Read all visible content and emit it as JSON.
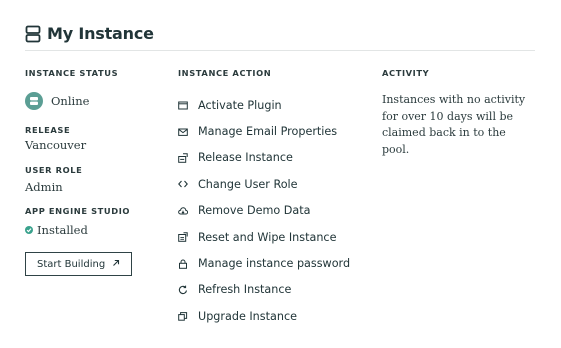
{
  "header": {
    "title": "My Instance"
  },
  "status": {
    "label": "INSTANCE STATUS",
    "value": "Online",
    "release_label": "RELEASE",
    "release_value": "Vancouver",
    "role_label": "USER ROLE",
    "role_value": "Admin",
    "studio_label": "APP ENGINE STUDIO",
    "studio_value": "Installed",
    "start_button": "Start Building",
    "status_color": "#5b9e94",
    "installed_color": "#3aa28d"
  },
  "actions": {
    "label": "INSTANCE ACTION",
    "items": [
      {
        "label": "Activate Plugin",
        "icon": "plugin-box-icon"
      },
      {
        "label": "Manage Email Properties",
        "icon": "envelope-icon"
      },
      {
        "label": "Release Instance",
        "icon": "release-icon"
      },
      {
        "label": "Change User Role",
        "icon": "code-brackets-icon"
      },
      {
        "label": "Remove Demo Data",
        "icon": "cloud-remove-icon"
      },
      {
        "label": "Reset and Wipe Instance",
        "icon": "reset-wipe-icon"
      },
      {
        "label": "Manage instance password",
        "icon": "lock-icon"
      },
      {
        "label": "Refresh Instance",
        "icon": "refresh-icon"
      },
      {
        "label": "Upgrade Instance",
        "icon": "upgrade-icon"
      }
    ]
  },
  "activity": {
    "label": "ACTIVITY",
    "text": "Instances with no activity for over 10 days will be claimed back in to the pool."
  }
}
